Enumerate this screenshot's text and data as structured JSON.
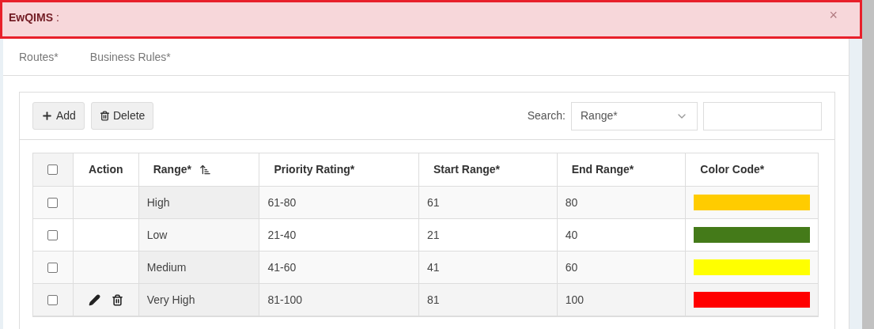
{
  "alert": {
    "title": "EwQIMS",
    "separator": ":",
    "close": "×"
  },
  "tabs": [
    {
      "label": "Routes*",
      "selected": false
    },
    {
      "label": "Business Rules*",
      "selected": false
    }
  ],
  "toolbar": {
    "buttons": [
      {
        "label": "Add",
        "kind": "add"
      },
      {
        "label": "Delete",
        "kind": "delete"
      }
    ],
    "search_label": "Search:",
    "search_column": "Range*"
  },
  "table": {
    "select_all_checked": false,
    "columns": [
      {
        "label": "Action",
        "sorted": false
      },
      {
        "label": "Range*",
        "sorted": true
      },
      {
        "label": "Priority Rating*",
        "sorted": false
      },
      {
        "label": "Start Range*",
        "sorted": false
      },
      {
        "label": "End Range*",
        "sorted": false
      },
      {
        "label": "Color Code*",
        "sorted": false
      }
    ],
    "rows": [
      {
        "checked": false,
        "show_actions": false,
        "range": "High",
        "priority_rating": "61-80",
        "start_range": "61",
        "end_range": "80",
        "color": "#ffcc00"
      },
      {
        "checked": false,
        "show_actions": false,
        "range": "Low",
        "priority_rating": "21-40",
        "start_range": "21",
        "end_range": "40",
        "color": "#447a19"
      },
      {
        "checked": false,
        "show_actions": false,
        "range": "Medium",
        "priority_rating": "41-60",
        "start_range": "41",
        "end_range": "60",
        "color": "#ffff00"
      },
      {
        "checked": false,
        "show_actions": true,
        "range": "Very High",
        "priority_rating": "81-100",
        "start_range": "81",
        "end_range": "100",
        "color": "#ff0000"
      }
    ]
  }
}
